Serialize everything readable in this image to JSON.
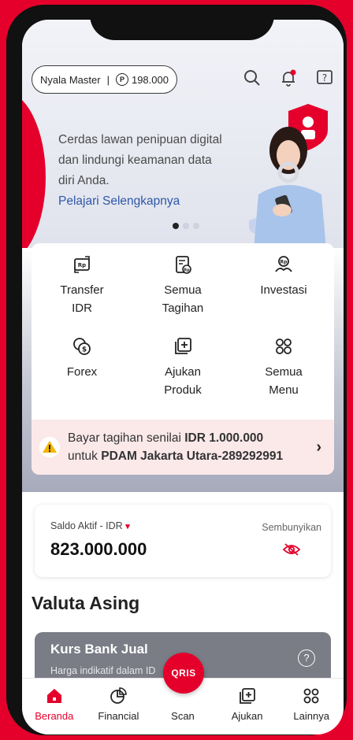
{
  "header": {
    "account_name": "Nyala Master",
    "points_separator": "|",
    "points_symbol": "P",
    "points_value": "198.000"
  },
  "hero": {
    "text_lines": [
      "Cerdas lawan penipuan digital",
      "dan lindungi keamanan data",
      "diri Anda."
    ],
    "link": "Pelajari Selengkapnya",
    "carousel_active_index": 0,
    "carousel_count": 3
  },
  "menu": {
    "items": [
      {
        "line1": "Transfer",
        "line2": "IDR",
        "icon": "rp-transfer-icon"
      },
      {
        "line1": "Semua",
        "line2": "Tagihan",
        "icon": "bill-icon"
      },
      {
        "line1": "Investasi",
        "line2": "",
        "icon": "investment-icon"
      },
      {
        "line1": "Forex",
        "line2": "",
        "icon": "forex-icon"
      },
      {
        "line1": "Ajukan",
        "line2": "Produk",
        "icon": "add-product-icon"
      },
      {
        "line1": "Semua",
        "line2": "Menu",
        "icon": "grid-icon"
      }
    ]
  },
  "bill_banner": {
    "prefix": "Bayar tagihan senilai ",
    "amount": "IDR 1.000.000",
    "middle": "untuk ",
    "target": "PDAM Jakarta Utara-289292991"
  },
  "saldo": {
    "label": "Saldo Aktif - IDR",
    "value": "823.000.000",
    "hide_label": "Sembunyikan"
  },
  "valuta": {
    "title": "Valuta Asing",
    "card_title": "Kurs Bank Jual",
    "card_subtitle": "Harga indikatif dalam ID"
  },
  "bottom_nav": {
    "items": [
      {
        "label": "Beranda",
        "icon": "home-icon",
        "active": true
      },
      {
        "label": "Financial",
        "icon": "pie-chart-icon",
        "active": false
      },
      {
        "label": "Scan",
        "icon": "qris-icon",
        "active": false
      },
      {
        "label": "Ajukan",
        "icon": "add-square-icon",
        "active": false
      },
      {
        "label": "Lainnya",
        "icon": "grid-icon",
        "active": false
      }
    ],
    "qris_label": "QRIS"
  },
  "colors": {
    "brand_red": "#e4002b",
    "link_blue": "#2f57a8",
    "warning_yellow": "#f5b400"
  }
}
